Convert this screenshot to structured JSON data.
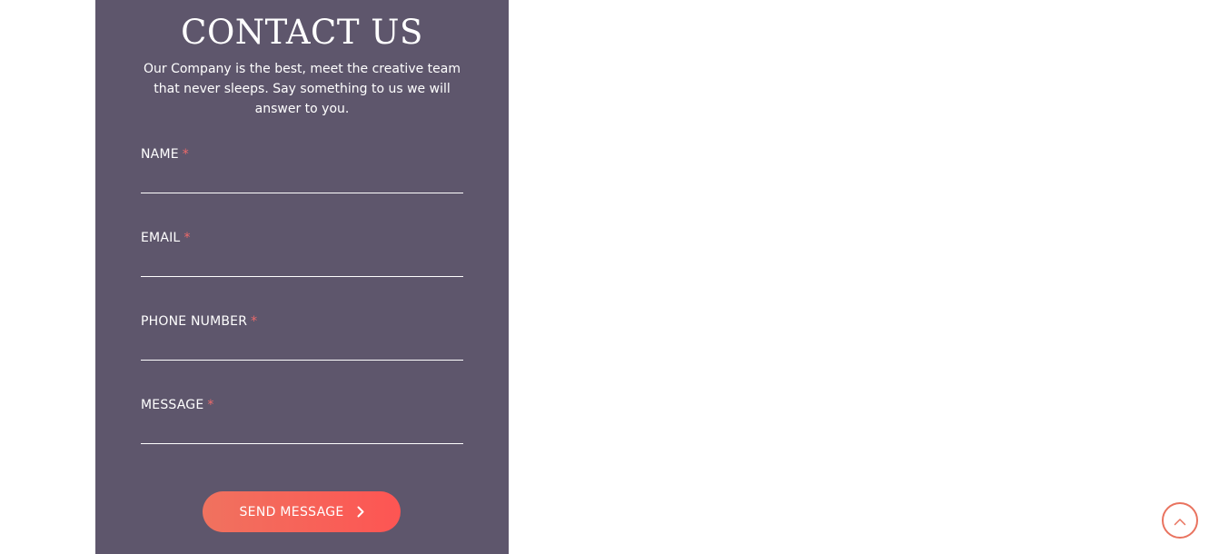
{
  "contact": {
    "title": "CONTACT US",
    "subtitle": "Our Company is the best, meet the creative team that never sleeps. Say something to us we will answer to you.",
    "required_mark": "*",
    "fields": [
      {
        "label": "NAME",
        "value": ""
      },
      {
        "label": "EMAIL",
        "value": ""
      },
      {
        "label": "PHONE NUMBER",
        "value": ""
      },
      {
        "label": "MESSAGE",
        "value": ""
      }
    ],
    "submit_label": "SEND MESSAGE",
    "submit_icon": "chevron-right-icon"
  },
  "scroll_top": {
    "icon": "chevron-up-icon"
  },
  "colors": {
    "panel_bg": "#5e566c",
    "accent_start": "#f0725f",
    "accent_end": "#fd5553",
    "required": "#ee6a6a"
  }
}
